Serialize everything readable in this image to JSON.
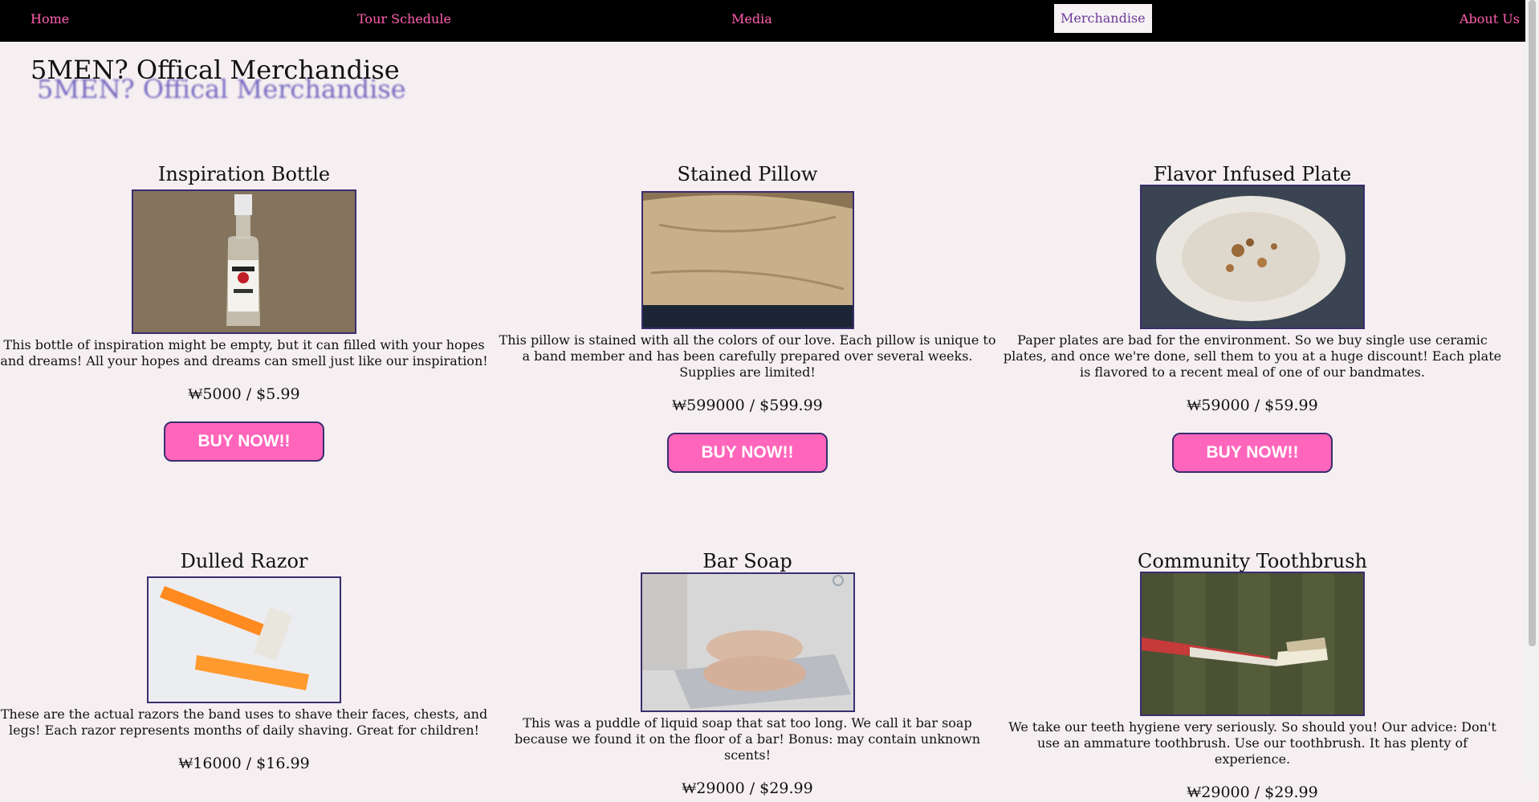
{
  "nav": {
    "home": "Home",
    "tour": "Tour Schedule",
    "media": "Media",
    "merch": "Merchandise",
    "about": "About Us"
  },
  "page": {
    "title": "5MEN? Offical Merchandise"
  },
  "products": [
    {
      "name": "Inspiration Bottle",
      "description": "This bottle of inspiration might be empty, but it can filled with your hopes and dreams! All your hopes and dreams can smell just like our inspiration!",
      "price": "₩5000 / $5.99",
      "button": "BUY NOW!!"
    },
    {
      "name": "Stained Pillow",
      "description": "This pillow is stained with all the colors of our love. Each pillow is unique to a band member and has been carefully prepared over several weeks. Supplies are limited!",
      "price": "₩599000 / $599.99",
      "button": "BUY NOW!!"
    },
    {
      "name": "Flavor Infused Plate",
      "description": "Paper plates are bad for the environment. So we buy single use ceramic plates, and once we're done, sell them to you at a huge discount! Each plate is flavored to a recent meal of one of our bandmates.",
      "price": "₩59000 / $59.99",
      "button": "BUY NOW!!"
    },
    {
      "name": "Dulled Razor",
      "description": "These are the actual razors the band uses to shave their faces, chests, and legs! Each razor represents months of daily shaving. Great for children!",
      "price": "₩16000 / $16.99"
    },
    {
      "name": "Bar Soap",
      "description": "This was a puddle of liquid soap that sat too long. We call it bar soap because we found it on the floor of a bar! Bonus: may contain unknown scents!",
      "price": "₩29000 / $29.99"
    },
    {
      "name": "Community Toothbrush",
      "description": "We take our teeth hygiene very seriously. So should you! Our advice: Don't use an ammature toothbrush. Use our toothbrush. It has plenty of experience.",
      "price": "₩29000 / $29.99"
    }
  ]
}
